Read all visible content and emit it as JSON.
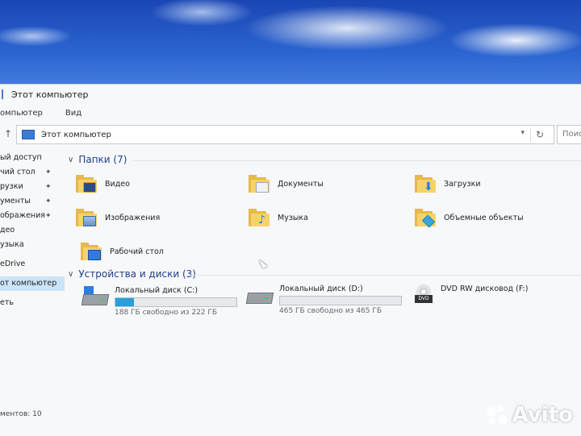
{
  "window": {
    "title": "Этот компьютер"
  },
  "ribbon": {
    "computer_tab": "омпьютер",
    "view_tab": "Вид"
  },
  "address": {
    "path": "Этот компьютер",
    "search_placeholder": "Поис"
  },
  "sidebar": {
    "items": [
      {
        "label": "ый доступ",
        "pinned": false
      },
      {
        "label": "чий стол",
        "pinned": true
      },
      {
        "label": "рузки",
        "pinned": true
      },
      {
        "label": "ументы",
        "pinned": true
      },
      {
        "label": "ображения",
        "pinned": true
      },
      {
        "label": "део",
        "pinned": false
      },
      {
        "label": "узыка",
        "pinned": false
      },
      {
        "label": "eDrive",
        "pinned": false
      },
      {
        "label": "от компьютер",
        "pinned": false
      },
      {
        "label": "еть",
        "pinned": false
      }
    ]
  },
  "folders_group": {
    "title": "Папки (7)"
  },
  "folders": [
    {
      "name": "Видео",
      "badge": "film",
      "badge_color": "#2a4a8a"
    },
    {
      "name": "Документы",
      "badge": "document",
      "badge_color": "#dfe6ef"
    },
    {
      "name": "Загрузки",
      "badge": "download-arrow",
      "badge_color": "#2b7de0"
    },
    {
      "name": "Изображения",
      "badge": "landscape",
      "badge_color": "#7fa8d8"
    },
    {
      "name": "Музыка",
      "badge": "music-note",
      "badge_color": "#2b7de0"
    },
    {
      "name": "Объемные объекты",
      "badge": "cube",
      "badge_color": "#37a6d8"
    },
    {
      "name": "Рабочий стол",
      "badge": "desktop",
      "badge_color": "#2b7de0"
    }
  ],
  "drives_group": {
    "title": "Устройства и диски (3)"
  },
  "drives": [
    {
      "name": "Локальный диск (C:)",
      "free": "188 ГБ свободно из 222 ГБ",
      "used_fraction": 0.153,
      "system": true
    },
    {
      "name": "Локальный диск (D:)",
      "free": "465 ГБ свободно из 465 ГБ",
      "used_fraction": 0.0,
      "system": false
    },
    {
      "name": "DVD RW дисковод (F:)",
      "label": "DVD"
    }
  ],
  "status": {
    "items_count": "ментов: 10"
  },
  "watermark": {
    "text": "Avito"
  },
  "colors": {
    "accent": "#26a0da",
    "group_title": "#1e3f8a",
    "folder": "#f6d26a",
    "selected": "#cce4f7"
  }
}
